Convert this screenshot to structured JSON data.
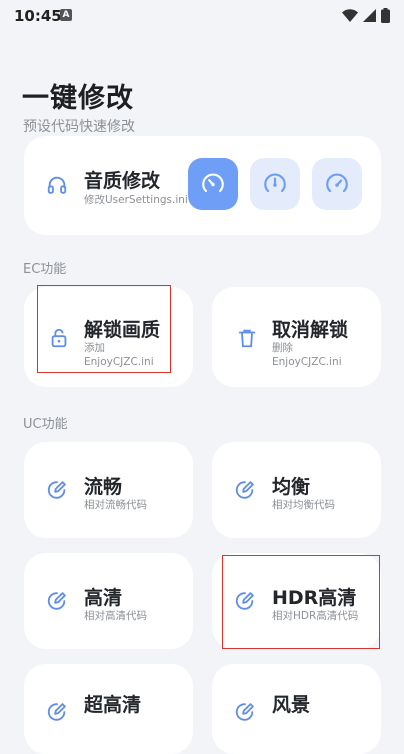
{
  "status_bar": {
    "time": "10:45",
    "notif_badge": "A"
  },
  "header": {
    "title": "一键修改",
    "subtitle": "预设代码快速修改"
  },
  "audio_card": {
    "title": "音质修改",
    "subtitle": "修改UserSettings.ini",
    "modes": [
      {
        "icon": "speedometer-fast-icon",
        "active": true
      },
      {
        "icon": "speedometer-mid-icon",
        "active": false
      },
      {
        "icon": "speedometer-icon",
        "active": false
      }
    ]
  },
  "sections": {
    "ec": "EC功能",
    "uc": "UC功能"
  },
  "ec_cards": [
    {
      "title": "解锁画质",
      "line1": "添加",
      "line2": "EnjoyCJZC.ini",
      "icon": "unlock-icon"
    },
    {
      "title": "取消解锁",
      "line1": "删除",
      "line2": "EnjoyCJZC.ini",
      "icon": "trash-icon"
    }
  ],
  "uc_cards": [
    {
      "title": "流畅",
      "subtitle": "相对流畅代码",
      "icon": "edit-icon"
    },
    {
      "title": "均衡",
      "subtitle": "相对均衡代码",
      "icon": "edit-icon"
    },
    {
      "title": "高清",
      "subtitle": "相对高清代码",
      "icon": "edit-icon"
    },
    {
      "title": "HDR高清",
      "subtitle": "相对HDR高清代码",
      "icon": "edit-icon"
    },
    {
      "title": "超高清",
      "subtitle": "",
      "icon": "edit-icon"
    },
    {
      "title": "风景",
      "subtitle": "",
      "icon": "edit-icon"
    }
  ],
  "colors": {
    "accent": "#6e9ef5",
    "accent_light": "#e4ecfb",
    "highlight": "#d9342b",
    "background": "#f3f4f7"
  }
}
